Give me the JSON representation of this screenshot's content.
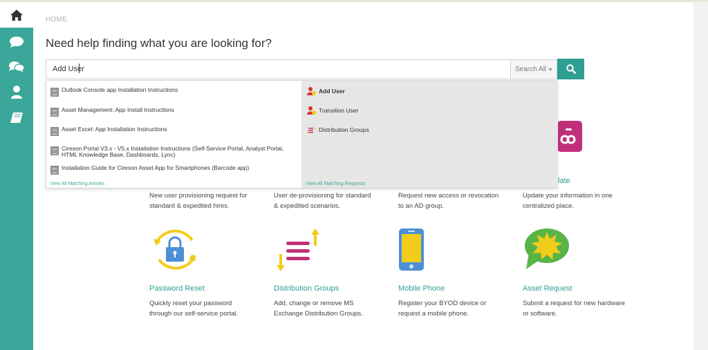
{
  "header": {
    "breadcrumb": "HOME",
    "title": "Need help finding what you are looking for?"
  },
  "search": {
    "value": "Add User",
    "scope_label": "Search All"
  },
  "suggestions": {
    "articles": [
      "Outlook Console app Installation Instructions",
      "Asset Management: App Install Instructions",
      "Asset Excel: App Installation Instructions",
      "Cireson Portal V3.x - V5.x Installation Instructions (Self-Service Portal, Analyst Portal, HTML Knowledge Base, Dashboards, Lync)",
      "Installation Guide for Cireson Asset App for Smartphones (Barcode app)"
    ],
    "view_all_articles": "View All Matching Articles",
    "requests": [
      "Add User",
      "Transition User",
      "Distribution Groups"
    ],
    "view_all_requests": "View All Matching Requests"
  },
  "tiles_row1": [
    {
      "desc_line1": "New user provisioning request for",
      "desc_line2": "standard & expedited hires."
    },
    {
      "desc_line1": "User de-provisioning for standard",
      "desc_line2": "& expedited scenarios."
    },
    {
      "desc_line1": "Request new access or revocation",
      "desc_line2": "to an AD group."
    },
    {
      "name_fragment": "late",
      "desc_line1": "Update your information in one",
      "desc_line2": "centralized place."
    }
  ],
  "tiles_row2": [
    {
      "name": "Password Reset",
      "icon": "lock-icon",
      "desc_line1": "Quickly reset your password",
      "desc_line2": "through our self-service portal."
    },
    {
      "name": "Distribution Groups",
      "icon": "distribution-arrows-icon",
      "desc_line1": "Add, change or remove MS",
      "desc_line2": "Exchange Distribution Groups."
    },
    {
      "name": "Mobile Phone",
      "icon": "mobile-phone-icon",
      "desc_line1": "Register your BYOD device or",
      "desc_line2": "request a mobile phone."
    },
    {
      "name": "Asset Request",
      "icon": "burst-bubble-icon",
      "desc_line1": "Submit a request for new hardware",
      "desc_line2": "or software."
    }
  ],
  "colors": {
    "sidebar": "#3aa79a",
    "accent": "#2e9f92",
    "highlight_pink": "#c0307a",
    "yellow": "#f2cc1a"
  }
}
